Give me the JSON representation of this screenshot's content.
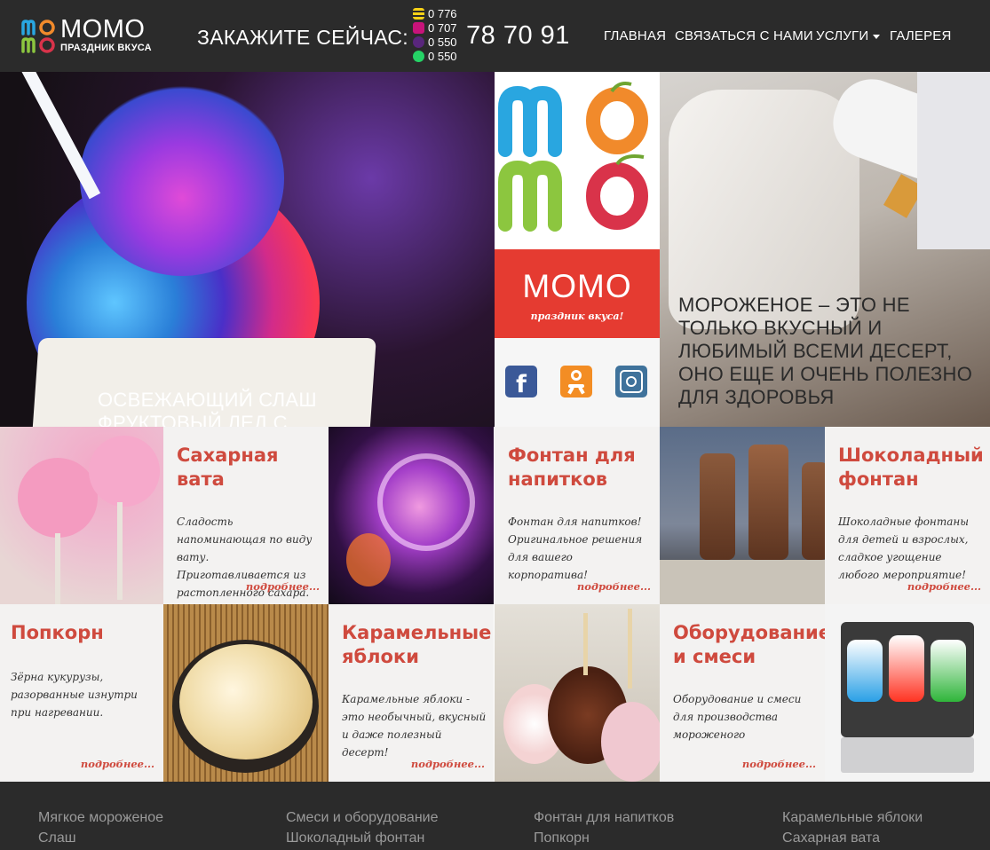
{
  "header": {
    "brand": "МОМО",
    "brand_subtitle": "ПРАЗДНИК ВКУСА",
    "order_label": "ЗАКАЖИТЕ СЕЙЧАС:",
    "phone_prefixes": [
      "0 776",
      "0 707",
      "0 550",
      "0 550"
    ],
    "phone_number": "78 70 91",
    "nav": [
      "ГЛАВНАЯ",
      "СВЯЗАТЬСЯ С НАМИ",
      "УСЛУГИ",
      "ГАЛЕРЕЯ"
    ]
  },
  "hero": {
    "left_caption": "ОСВЕЖАЮЩИЙ СЛАШ ФРУКТОВЫЙ ЛЕД С НАТУРАЛЬНЫМИ ИНГРЕДИЕНТАМИ",
    "center": {
      "logo_text": "МОМО",
      "logo_tagline": "праздник вкуса!",
      "social": [
        "facebook-icon",
        "odnoklassniki-icon",
        "instagram-icon"
      ]
    },
    "right_caption": "МОРОЖЕНОЕ – ЭТО НЕ ТОЛЬКО ВКУСНЫЙ И ЛЮБИМЫЙ ВСЕМИ ДЕСЕРТ, ОНО ЕЩЕ И ОЧЕНЬ ПОЛЕЗНО ДЛЯ ЗДОРОВЬЯ"
  },
  "services": [
    {
      "title": "Сахарная вата",
      "text": "Сладость напоминающая по виду вату. Приготавливается из растопленного сахара.",
      "more": "подробнее..."
    },
    {
      "title": "Фонтан для напитков",
      "text": "Фонтан для напитков! Оригинальное решения для вашего корпоратива!",
      "more": "подробнее..."
    },
    {
      "title": "Шоколадный фонтан",
      "text": "Шоколадные фонтаны для детей и взрослых, сладкое угощение любого мероприятие!",
      "more": "подробнее..."
    },
    {
      "title": "Попкорн",
      "text": "Зёрна кукурузы, разорванные изнутри при нагревании.",
      "more": "подробнее..."
    },
    {
      "title": "Карамельные яблоки",
      "text": "Карамельные яблоки - это необычный, вкусный и даже полезный десерт!",
      "more": "подробнее..."
    },
    {
      "title": "Оборудование и смеси",
      "text": "Оборудование и смеси для производства мороженого",
      "more": "подробнее..."
    }
  ],
  "footer": {
    "links": [
      "Мягкое мороженое",
      "Слаш",
      "Смеси и оборудование",
      "Шоколадный фонтан",
      "Фонтан для напитков",
      "Попкорн",
      "Карамельные яблоки",
      "Сахарная вата"
    ]
  },
  "colors": {
    "header_bg": "#2b2b2b",
    "accent_red": "#cf4a3e",
    "tile_bg": "#f3f2f1",
    "center_red": "#e53b31",
    "facebook": "#3b5998",
    "odnoklassniki": "#f38d24",
    "instagram": "#3f729b"
  }
}
